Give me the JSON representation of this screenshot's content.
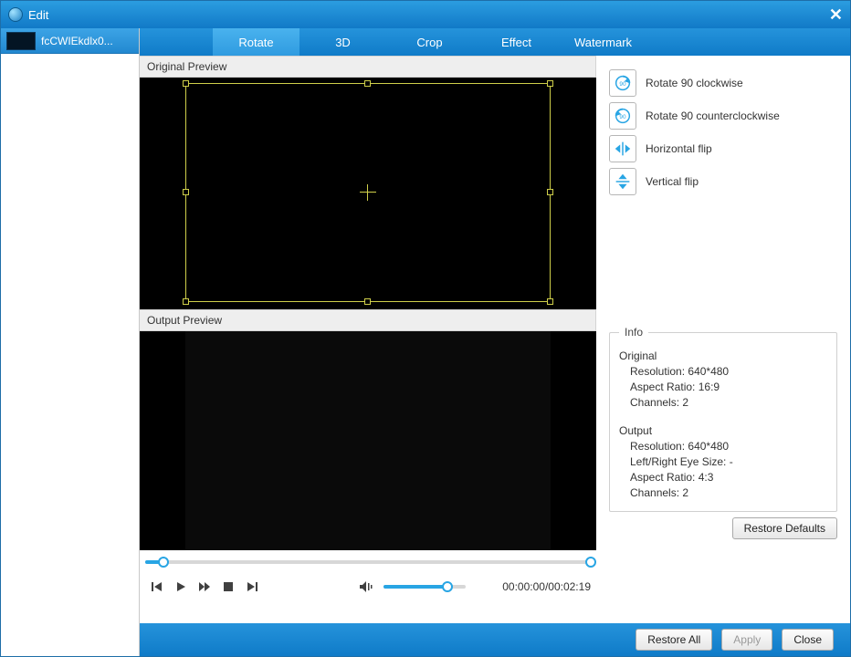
{
  "window": {
    "title": "Edit"
  },
  "sidebar": {
    "items": [
      {
        "name": "fcCWIEkdlx0..."
      }
    ]
  },
  "tabs": {
    "rotate": "Rotate",
    "threeD": "3D",
    "crop": "Crop",
    "effect": "Effect",
    "watermark": "Watermark",
    "active": "rotate"
  },
  "previews": {
    "original_label": "Original Preview",
    "output_label": "Output Preview"
  },
  "actions": {
    "rotate_cw": "Rotate 90 clockwise",
    "rotate_ccw": "Rotate 90 counterclockwise",
    "hflip": "Horizontal flip",
    "vflip": "Vertical flip"
  },
  "player": {
    "position": "00:00:00",
    "duration": "00:02:19",
    "separator": "/"
  },
  "info": {
    "legend": "Info",
    "original": {
      "title": "Original",
      "resolution_label": "Resolution:",
      "resolution_value": "640*480",
      "aspect_label": "Aspect Ratio:",
      "aspect_value": "16:9",
      "channels_label": "Channels:",
      "channels_value": "2"
    },
    "output": {
      "title": "Output",
      "resolution_label": "Resolution:",
      "resolution_value": "640*480",
      "eye_label": "Left/Right Eye Size:",
      "eye_value": "-",
      "aspect_label": "Aspect Ratio:",
      "aspect_value": "4:3",
      "channels_label": "Channels:",
      "channels_value": "2"
    }
  },
  "buttons": {
    "restore_defaults": "Restore Defaults",
    "restore_all": "Restore All",
    "apply": "Apply",
    "close": "Close"
  }
}
